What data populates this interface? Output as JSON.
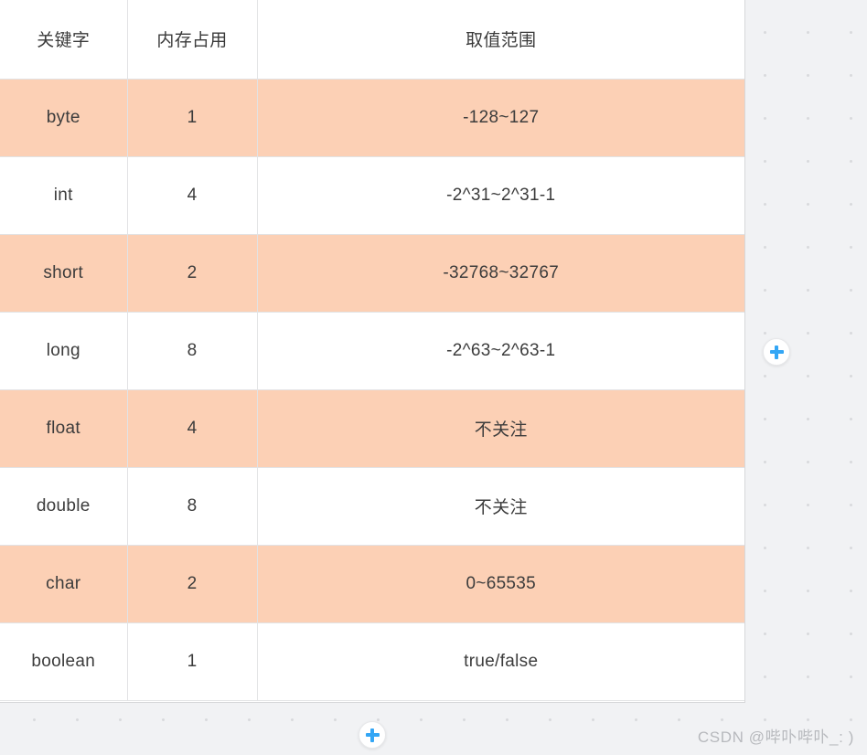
{
  "table": {
    "headers": [
      "关键字",
      "内存占用",
      "取值范围"
    ],
    "rows": [
      {
        "keyword": "byte",
        "memory": "1",
        "range": "-128~127"
      },
      {
        "keyword": "int",
        "memory": "4",
        "range": "-2^31~2^31-1"
      },
      {
        "keyword": "short",
        "memory": "2",
        "range": "-32768~32767"
      },
      {
        "keyword": "long",
        "memory": "8",
        "range": "-2^63~2^63-1"
      },
      {
        "keyword": "float",
        "memory": "4",
        "range": "不关注"
      },
      {
        "keyword": "double",
        "memory": "8",
        "range": "不关注"
      },
      {
        "keyword": "char",
        "memory": "2",
        "range": "0~65535"
      },
      {
        "keyword": "boolean",
        "memory": "1",
        "range": "true/false"
      }
    ]
  },
  "controls": {
    "add_column": "plus-icon",
    "add_row": "plus-icon"
  },
  "watermark": {
    "text": "CSDN @哔卟哔卟_: )"
  },
  "colors": {
    "row_highlight": "#fcd0b5",
    "row_plain": "#ffffff",
    "canvas": "#f1f2f4",
    "grid_dot": "#d9dadd",
    "accent": "#33a6f5",
    "text": "#3c3c3c",
    "watermark": "#b7b9bd",
    "cell_border": "#e2e3e5"
  }
}
